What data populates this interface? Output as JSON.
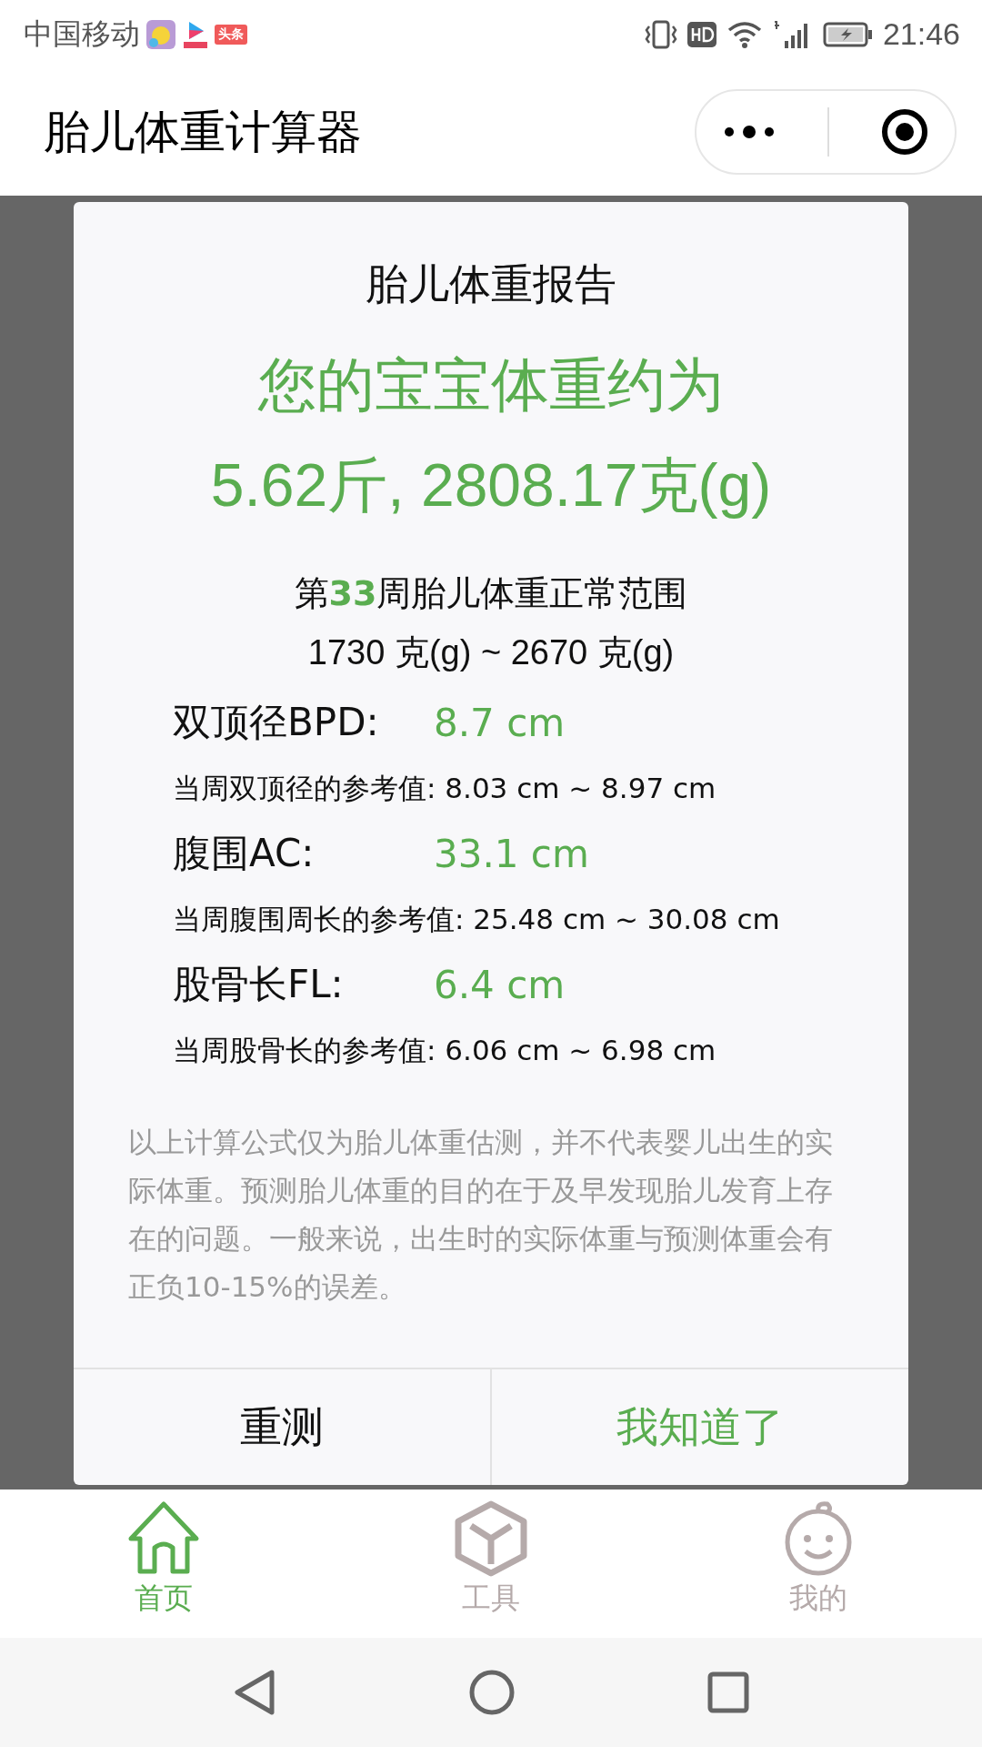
{
  "status_bar": {
    "carrier": "中国移动",
    "news_badge": "头条",
    "time": "21:46"
  },
  "header": {
    "title": "胎儿体重计算器"
  },
  "dialog": {
    "title": "胎儿体重报告",
    "headline": "您的宝宝体重约为",
    "weight": "5.62斤, 2808.17克(g)",
    "range_title": {
      "prefix": "第",
      "week": "33",
      "suffix": "周胎儿体重正常范围"
    },
    "range": "1730 克(g) ~ 2670 克(g)",
    "measures": [
      {
        "label": "双顶径BPD:",
        "value": "8.7 cm",
        "reference": "当周双顶径的参考值: 8.03 cm ~ 8.97 cm"
      },
      {
        "label": "腹围AC:",
        "value": "33.1 cm",
        "reference": "当周腹围周长的参考值: 25.48 cm ~ 30.08 cm"
      },
      {
        "label": "股骨长FL:",
        "value": "6.4 cm",
        "reference": "当周股骨长的参考值: 6.06 cm ~ 6.98 cm"
      }
    ],
    "disclaimer": "以上计算公式仅为胎儿体重估测，并不代表婴儿出生的实际体重。预测胎儿体重的目的在于及早发现胎儿发育上存在的问题。一般来说，出生时的实际体重与预测体重会有正负10-15%的误差。",
    "buttons": [
      {
        "label": "重测",
        "kind": "secondary"
      },
      {
        "label": "我知道了",
        "kind": "primary"
      }
    ]
  },
  "tabs": [
    {
      "label": "首页",
      "kind": "home",
      "selected": true
    },
    {
      "label": "工具",
      "kind": "tools",
      "selected": false
    },
    {
      "label": "我的",
      "kind": "profile",
      "selected": false
    }
  ]
}
